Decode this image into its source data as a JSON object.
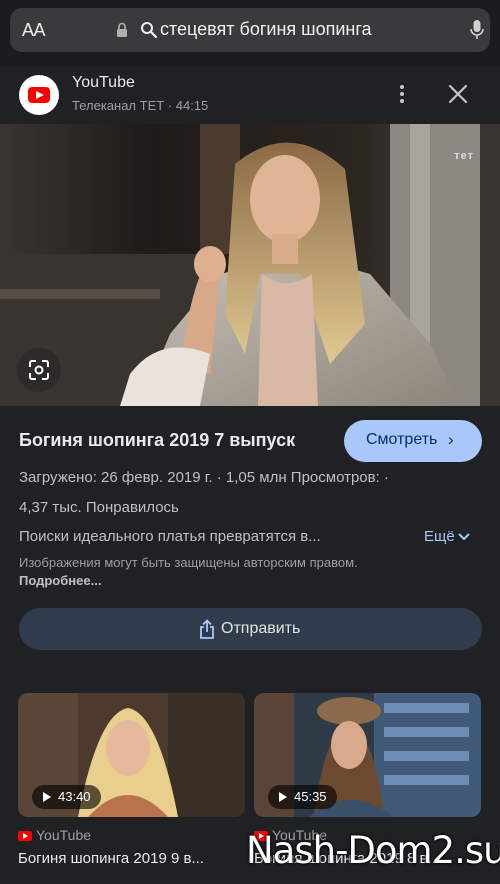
{
  "address_bar": {
    "text_size_label": "AA",
    "query": "стецевят богиня шопинга",
    "icons": [
      "lock-icon",
      "search-icon",
      "microphone-icon"
    ]
  },
  "result": {
    "source": "YouTube",
    "channel_meta": "Телеканал ТЕТ · 44:15",
    "thumbnail_logo": "тет",
    "title": "Богиня шопинга 2019 7 выпуск",
    "watch_label": "Смотреть",
    "stats_line1": "Загружено: 26 февр. 2019 г.  ·  1,05 млн Просмотров:  ·",
    "stats_line2": "4,37 тыс. Понравилось",
    "description": "Поиски идеального платья превратятся в...",
    "more_label": "Ещё",
    "copyright_text": "Изображения могут быть защищены авторским правом.",
    "copyright_link": "Подробнее...",
    "share_label": "Отправить"
  },
  "related": [
    {
      "duration": "43:40",
      "source": "YouTube",
      "title": "Богиня шопинга 2019 9 в..."
    },
    {
      "duration": "45:35",
      "source": "YouTube",
      "title": "Богиня шопинга 2019 8 в..."
    }
  ],
  "watermark": "Nash-Dom2.su",
  "colors": {
    "accent_button": "#a8c7fa",
    "share_button": "#303c4c",
    "background": "#202124"
  }
}
